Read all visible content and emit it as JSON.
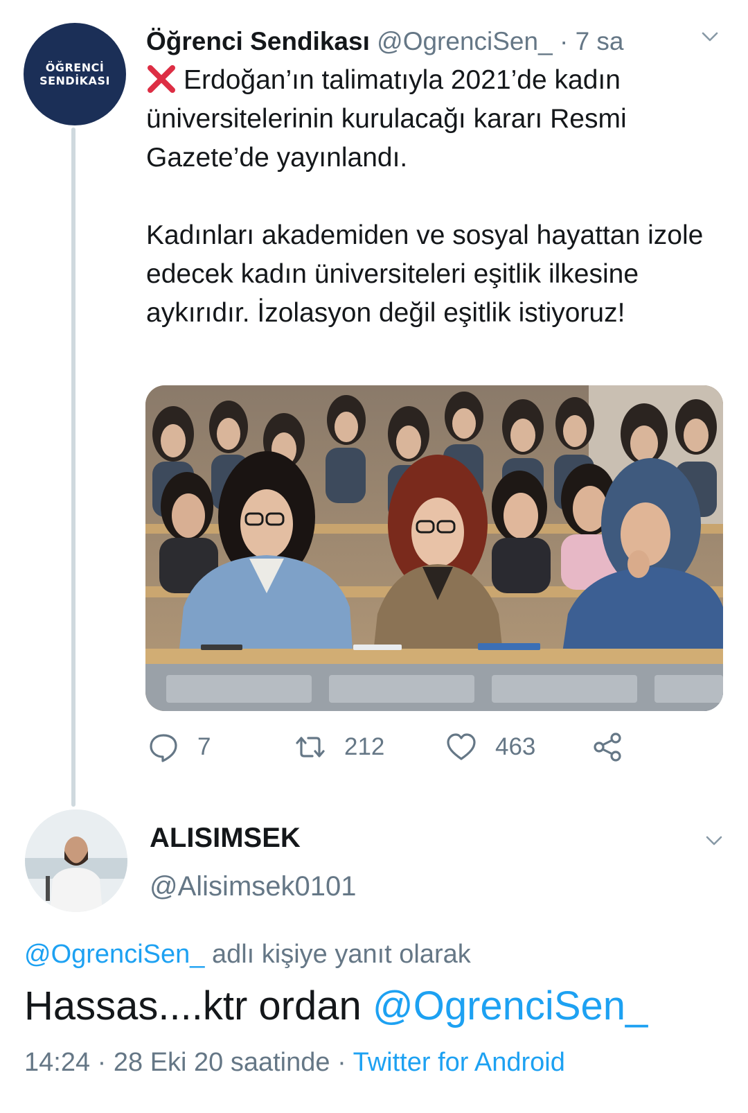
{
  "tweet": {
    "avatar_text_line1": "ÖĞRENCİ",
    "avatar_text_line2": "SENDİKASI",
    "display_name": "Öğrenci Sendikası",
    "handle": "@OgrenciSen_",
    "separator": " · ",
    "time": "7 sa",
    "emoji_icon": "red-cross-mark-icon",
    "paragraph1": "Erdoğan’ın talimatıyla 2021’de kadın üniversitelerinin kurulacağı kararı Resmi Gazete’de yayınlandı.",
    "paragraph2": "Kadınları akademiden ve sosyal hayattan izole edecek kadın üniversiteleri eşitlik ilkesine aykırıdır. İzolasyon değil eşitlik istiyoruz!",
    "media_icon": "classroom-students-photo",
    "actions": {
      "replies": "7",
      "retweets": "212",
      "likes": "463"
    }
  },
  "reply": {
    "display_name": "ALISIMSEK",
    "handle": "@Alisimsek0101",
    "replying_to_handle": "@OgrenciSen_",
    "replying_to_suffix": " adlı kişiye yanıt olarak",
    "text": "Hassas....ktr ordan ",
    "text_mention": "@OgrenciSen_",
    "time": "14:24 · 28 Eki 20 saatinde · ",
    "client": "Twitter for Android"
  },
  "colors": {
    "accent": "#1da1f2",
    "secondary_text": "#657786",
    "primary_text": "#14171a",
    "avatar_bg": "#1b2f57",
    "thread_line": "#cfd9de",
    "cross_red": "#dd2e44"
  }
}
